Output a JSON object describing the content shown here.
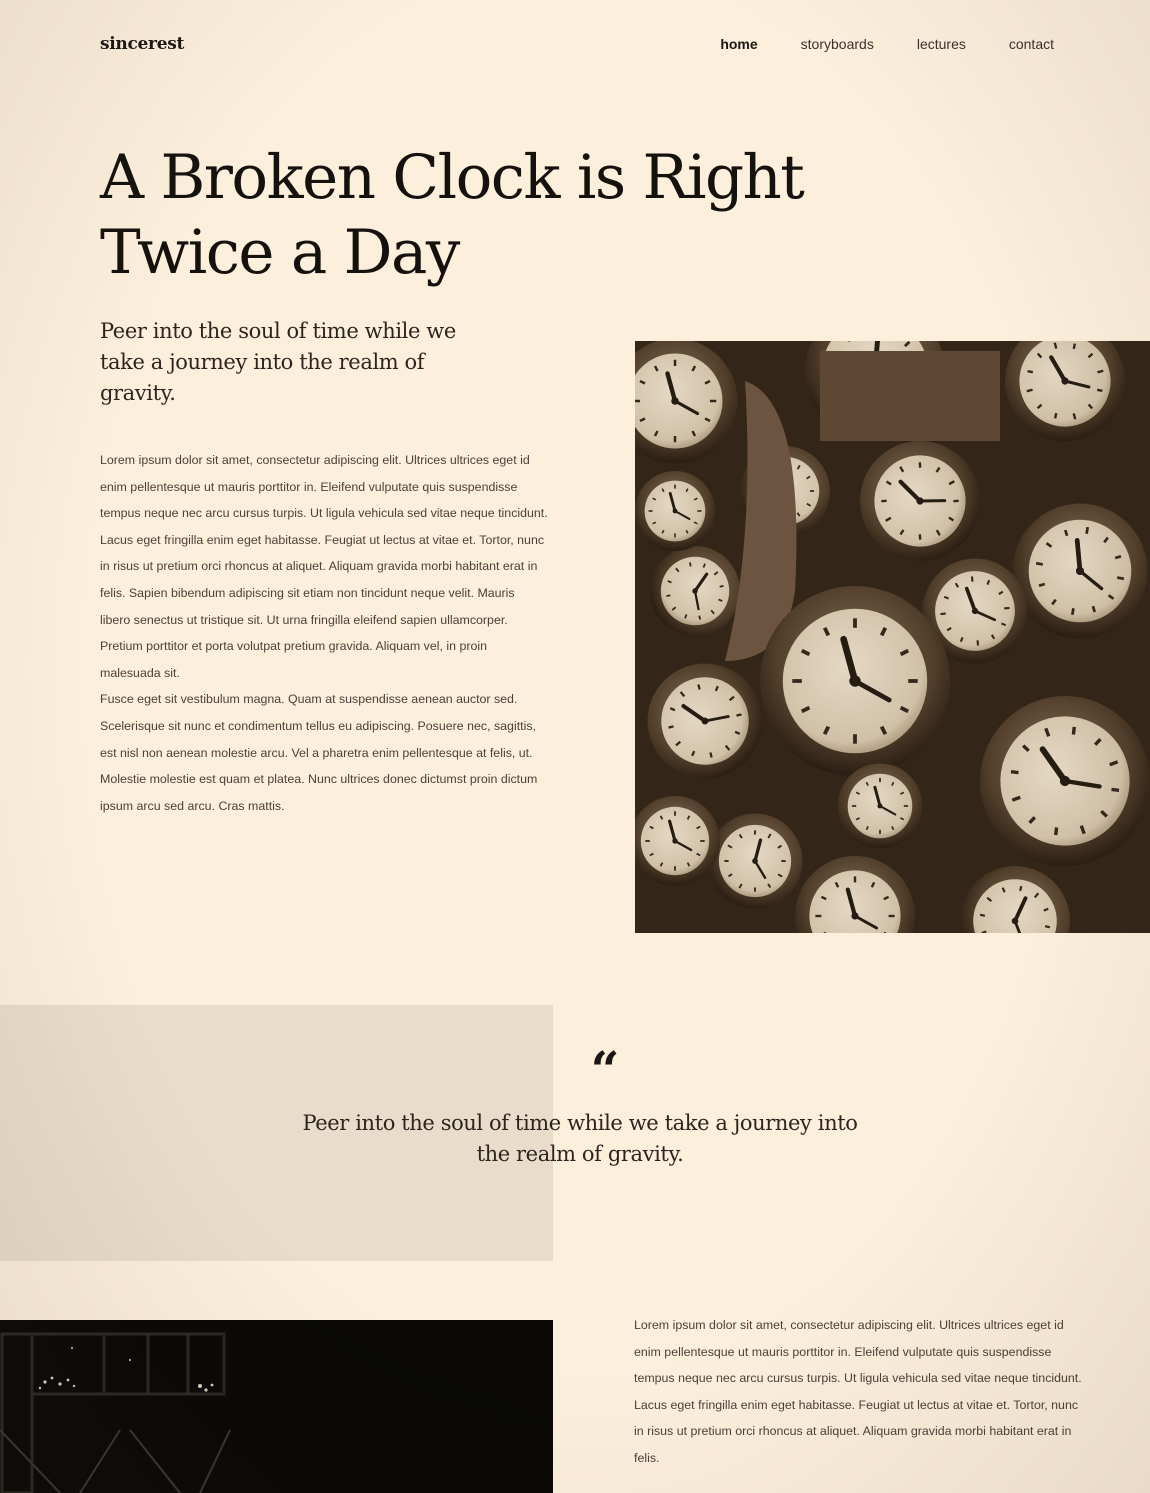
{
  "brand": {
    "logo": "sincerest"
  },
  "nav": {
    "items": [
      {
        "label": "home",
        "active": true
      },
      {
        "label": "storyboards",
        "active": false
      },
      {
        "label": "lectures",
        "active": false
      },
      {
        "label": "contact",
        "active": false
      }
    ]
  },
  "hero": {
    "title_line1": "A Broken Clock is Right",
    "title_line2": "Twice a Day",
    "subtitle": "Peer into the soul of time while we take a journey into the realm of gravity.",
    "paragraph1": "Lorem ipsum dolor sit amet, consectetur adipiscing elit. Ultrices ultrices eget id enim pellentesque ut mauris porttitor in. Eleifend vulputate quis suspendisse tempus neque nec arcu cursus turpis. Ut ligula vehicula sed vitae neque tincidunt. Lacus eget fringilla enim eget habitasse. Feugiat ut lectus at vitae et. Tortor, nunc in risus ut pretium orci rhoncus at aliquet. Aliquam gravida morbi habitant erat in felis. Sapien bibendum adipiscing sit etiam non tincidunt neque velit. Mauris libero senectus ut tristique sit. Ut urna fringilla eleifend sapien ullamcorper. Pretium porttitor et porta volutpat pretium gravida. Aliquam vel, in proin malesuada sit.",
    "paragraph2": "Fusce eget sit vestibulum magna. Quam at suspendisse aenean auctor sed. Scelerisque sit nunc et condimentum tellus eu adipiscing. Posuere nec, sagittis, est nisl non aenean molestie arcu. Vel a pharetra enim pellentesque at felis, ut. Molestie molestie est quam et platea. Nunc ultrices donec dictumst proin dictum ipsum arcu sed arcu. Cras mattis."
  },
  "quote": {
    "mark": "“",
    "text": "Peer into the soul of time while we take a journey into the realm of gravity."
  },
  "section2": {
    "paragraph": "Lorem ipsum dolor sit amet, consectetur adipiscing elit. Ultrices ultrices eget id enim pellentesque ut mauris porttitor in. Eleifend vulputate quis suspendisse tempus neque nec arcu cursus turpis. Ut ligula vehicula sed vitae neque tincidunt. Lacus eget fringilla enim eget habitasse. Feugiat ut lectus at vitae et. Tortor, nunc in risus ut pretium orci rhoncus at aliquet. Aliquam gravida morbi habitant erat in felis."
  },
  "colors": {
    "background": "#fcefdc",
    "quote_band": "#e9dccb",
    "text": "#1b1712"
  }
}
